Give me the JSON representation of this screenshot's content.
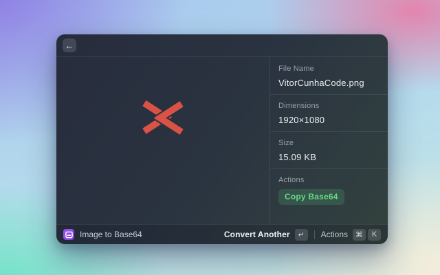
{
  "window": {
    "header": {
      "back_icon": "←"
    },
    "detail": {
      "sections": [
        {
          "label": "File Name",
          "value": "VitorCunhaCode.png"
        },
        {
          "label": "Dimensions",
          "value": "1920×1080"
        },
        {
          "label": "Size",
          "value": "15.09 KB"
        }
      ],
      "actions_label": "Actions",
      "copy_badge_label": "Copy Base64"
    },
    "footer": {
      "extension_label": "Image to Base64",
      "primary_action_label": "Convert Another",
      "primary_key": "↵",
      "secondary_action_label": "Actions",
      "cmd_key": "⌘",
      "k_key": "K"
    }
  },
  "colors": {
    "logo_red": "#d95245",
    "logo_gap": "#273140",
    "badge_green": "#65da85",
    "icon_purple": "#8e4ce0"
  }
}
